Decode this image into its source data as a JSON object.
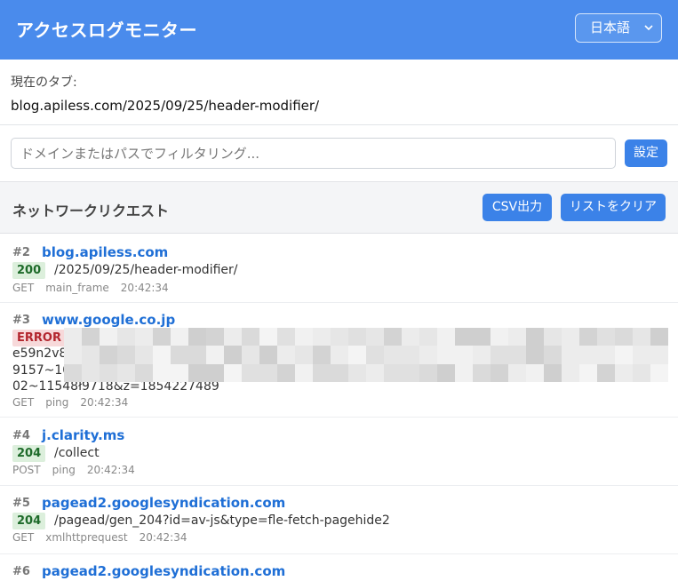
{
  "header": {
    "title": "アクセスログモニター",
    "language": "日本語"
  },
  "current_tab": {
    "label": "現在のタブ:",
    "url": "blog.apiless.com/2025/09/25/header-modifier/"
  },
  "filter": {
    "placeholder": "ドメインまたはパスでフィルタリング...",
    "value": "",
    "settings_label": "設定"
  },
  "requests_section": {
    "title": "ネットワークリクエスト",
    "csv_label": "CSV出力",
    "clear_label": "リストをクリア"
  },
  "requests": [
    {
      "num": "#2",
      "host": "blog.apiless.com",
      "status": "200",
      "path": "/2025/09/25/header-modifier/",
      "method": "GET",
      "type": "main_frame",
      "time": "20:42:34"
    },
    {
      "num": "#3",
      "host": "www.google.co.jp",
      "status": "ERROR",
      "error_lines": [
        "e59n2v89",
        "9157~103",
        "02~11548ł9718&z=1854227489"
      ],
      "method": "GET",
      "type": "ping",
      "time": "20:42:34"
    },
    {
      "num": "#4",
      "host": "j.clarity.ms",
      "status": "204",
      "path": "/collect",
      "method": "POST",
      "type": "ping",
      "time": "20:42:34"
    },
    {
      "num": "#5",
      "host": "pagead2.googlesyndication.com",
      "status": "204",
      "path": "/pagead/gen_204?id=av-js&type=fle-fetch-pagehide2",
      "method": "GET",
      "type": "xmlhttprequest",
      "time": "20:42:34"
    },
    {
      "num": "#6",
      "host": "pagead2.googlesyndication.com"
    }
  ],
  "colors": {
    "header_bg": "#4a8bec",
    "button_bg": "#3b82e8",
    "host_link": "#1f6fd6",
    "ok_badge_bg": "#dcefdc",
    "error_badge_bg": "#f7d9da"
  },
  "icons": {
    "language_dropdown": "chevron-down-icon"
  }
}
